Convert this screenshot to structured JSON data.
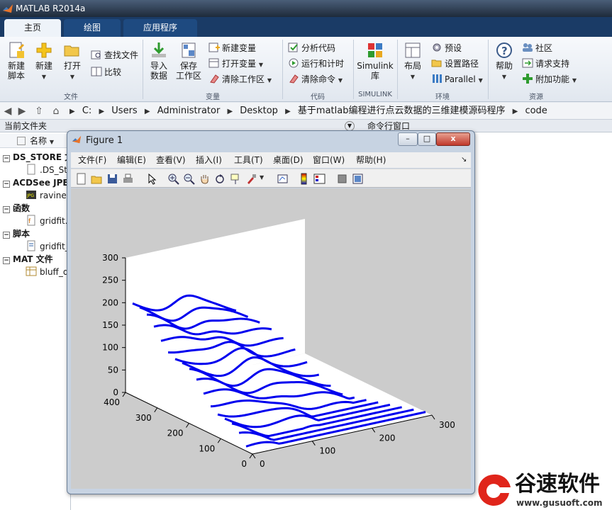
{
  "app": {
    "title": "MATLAB R2014a"
  },
  "tabs": [
    {
      "label": "主页",
      "active": true
    },
    {
      "label": "绘图",
      "active": false
    },
    {
      "label": "应用程序",
      "active": false
    }
  ],
  "ribbon": {
    "file": {
      "label": "文件",
      "new_script": "新建\n脚本",
      "new": "新建",
      "open": "打开",
      "find_files": "查找文件",
      "compare": "比较"
    },
    "variable": {
      "label": "变量",
      "import_data": "导入\n数据",
      "save_workspace": "保存\n工作区",
      "new_variable": "新建变量",
      "open_variable": "打开变量",
      "clear_workspace": "清除工作区"
    },
    "code": {
      "label": "代码",
      "analyze_code": "分析代码",
      "run_and_time": "运行和计时",
      "clear_commands": "清除命令"
    },
    "simulink": {
      "label": "SIMULINK",
      "library": "Simulink\n库"
    },
    "environment": {
      "label": "环境",
      "layout": "布局",
      "preferences": "预设",
      "set_path": "设置路径",
      "parallel": "Parallel"
    },
    "resources": {
      "label": "资源",
      "help": "帮助",
      "community": "社区",
      "request_support": "请求支持",
      "add_ons": "附加功能"
    }
  },
  "address": {
    "crumbs": [
      "C:",
      "Users",
      "Administrator",
      "Desktop",
      "基于matlab编程进行点云数据的三维建模源码程序",
      "code"
    ]
  },
  "left_panel": {
    "title": "当前文件夹",
    "column_name": "名称",
    "groups": [
      {
        "label": "DS_STORE 文",
        "items": [
          ".DS_St"
        ]
      },
      {
        "label": "ACDSee JPEG",
        "items": [
          "ravine."
        ]
      },
      {
        "label": "函数",
        "items": [
          "gridfit."
        ]
      },
      {
        "label": "脚本",
        "items": [
          "gridfit_"
        ]
      },
      {
        "label": "MAT 文件",
        "items": [
          "bluff_d"
        ]
      }
    ]
  },
  "right_panel": {
    "title": "命令行窗口"
  },
  "figure": {
    "title": "Figure 1",
    "menus": [
      "文件(F)",
      "编辑(E)",
      "查看(V)",
      "插入(I)",
      "工具(T)",
      "桌面(D)",
      "窗口(W)",
      "帮助(H)"
    ],
    "min_btn": "–",
    "max_btn": "□",
    "close_btn": "x"
  },
  "colors": {
    "plot_line": "#0000ee",
    "figure_bg": "#cccccc",
    "watermark_red": "#e0251b"
  },
  "chart_data": {
    "type": "line",
    "title": "",
    "xlabel": "",
    "ylabel": "",
    "zlabel": "",
    "x_ticks": [
      "0",
      "100",
      "200",
      "300"
    ],
    "y_ticks": [
      "0",
      "100",
      "200",
      "300",
      "400"
    ],
    "z_ticks": [
      "0",
      "50",
      "100",
      "150",
      "200",
      "250",
      "300"
    ],
    "xlim": [
      0,
      300
    ],
    "ylim": [
      0,
      400
    ],
    "zlim": [
      0,
      300
    ],
    "grid": false,
    "series_count": 17,
    "description": "stacked 3D contour-like scan lines"
  },
  "watermark": {
    "title": "谷速软件",
    "url": "www.gusuoft.com"
  }
}
